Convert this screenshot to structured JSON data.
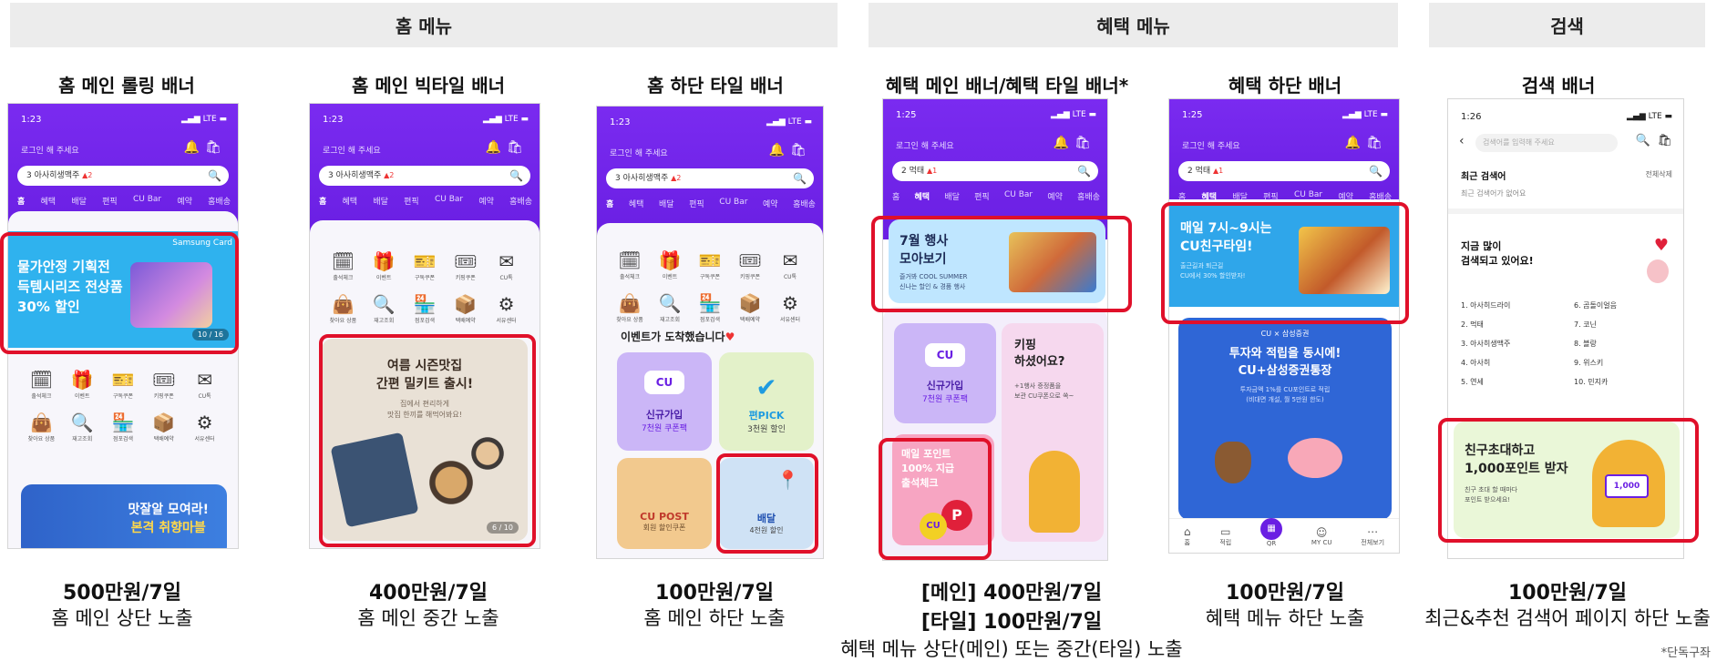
{
  "sections": {
    "home": "홈 메뉴",
    "benefit": "혜택 메뉴",
    "search": "검색"
  },
  "columns": [
    {
      "title": "홈 메인 롤링 배너",
      "price": "500만원/7일",
      "desc": "홈 메인 상단 노출"
    },
    {
      "title": "홈 메인 빅타일 배너",
      "price": "400만원/7일",
      "desc": "홈 메인 중간 노출"
    },
    {
      "title": "홈 하단 타일 배너",
      "price": "100만원/7일",
      "desc": "홈 메인 하단 노출"
    },
    {
      "title": "혜택 메인 배너/혜택 타일 배너*",
      "price_main": "[메인] 400만원/7일",
      "price_tile": "[타일] 100만원/7일",
      "desc": "혜택 메뉴 상단(메인) 또는 중간(타일) 노출"
    },
    {
      "title": "혜택 하단 배너",
      "price": "100만원/7일",
      "desc": "혜택 메뉴 하단 노출"
    },
    {
      "title": "검색 배너",
      "price": "100만원/7일",
      "desc": "최근&추천 검색어 페이지 하단 노출"
    }
  ],
  "note": "*단독구좌",
  "phone": {
    "time_a": "1:23",
    "time_b": "1:25",
    "time_c": "1:26",
    "signal": "▂▄▆ LTE ▬",
    "login": "로그인 해 주세요",
    "search_home": "3  아사히생맥주",
    "search_home_rank": "▲2",
    "search_benefit": "2  먹태",
    "search_benefit_rank": "▲1",
    "tabs": [
      "홈",
      "혜택",
      "배달",
      "편픽",
      "CU Bar",
      "예약",
      "홈배송"
    ],
    "icons": [
      {
        "icon": "calendar-check-icon",
        "glyph": "🗓",
        "label": "출석체크"
      },
      {
        "icon": "gift-icon",
        "glyph": "🎁",
        "label": "이벤트"
      },
      {
        "icon": "coupon-icon",
        "glyph": "🎫",
        "label": "구독쿠폰"
      },
      {
        "icon": "ticket-icon",
        "glyph": "🎟",
        "label": "키핑쿠폰"
      },
      {
        "icon": "mail-icon",
        "glyph": "✉",
        "label": "CU톡"
      },
      {
        "icon": "bag-icon",
        "glyph": "👜",
        "label": "찾아요 상품"
      },
      {
        "icon": "search-doc-icon",
        "glyph": "🔍",
        "label": "재고조회"
      },
      {
        "icon": "store-icon",
        "glyph": "🏪",
        "label": "점포검색"
      },
      {
        "icon": "box-icon",
        "glyph": "📦",
        "label": "택배예약"
      },
      {
        "icon": "settings-icon",
        "glyph": "⚙",
        "label": "서유센터"
      }
    ]
  },
  "banners": {
    "rolling": {
      "line1": "물가안정 기획전",
      "line2": "득템시리즈 전상품",
      "line3": "30% 할인",
      "brand": "Samsung Card",
      "page": "10 / 16"
    },
    "rolling_next": {
      "line1": "맛잘알 모여라!",
      "line2": "본격 취향마블"
    },
    "bigtile": {
      "line1": "여름 시즌맛집",
      "line2": "간편 밀키트 출시!",
      "sub1": "집에서 편리하게",
      "sub2": "맛집 한끼를 해먹어봐요!",
      "page": "6 / 10"
    },
    "event_heading": "이벤트가 도착했습니다",
    "tile_signup": {
      "line1": "신규가입",
      "line2": "7천원 쿠폰팩"
    },
    "tile_pick": {
      "line1": "편PICK",
      "line2": "3천원 할인"
    },
    "tile_post": {
      "line1": "CU POST",
      "line2": "회원 할인쿠폰"
    },
    "tile_delivery": {
      "line1": "배달",
      "line2": "4천원 할인"
    },
    "benefit_main": {
      "line1": "7월 행사",
      "line2": "모아보기",
      "sub1": "즐거봐 COOL SUMMER",
      "sub2": "신나는 할인 & 경품 행사"
    },
    "benefit_keep": {
      "line1": "키핑",
      "line2": "하셨어요?",
      "sub1": "+1행사 증정품을",
      "sub2": "보관 CU쿠폰으로 쏙~"
    },
    "benefit_point": {
      "line1": "매일 포인트",
      "line2": "100% 지급",
      "line3": "출석체크"
    },
    "benefit_bottom": {
      "line1": "매일 7시~9시는",
      "line2": "CU친구타임!",
      "sub1": "출근길과 퇴근길",
      "sub2": "CU에서 30% 할인받자!"
    },
    "benefit_invest": {
      "brand": "CU × 삼성증권",
      "line1": "투자와 적립을 동시에!",
      "line2": "CU+삼성증권통장",
      "sub1": "투자금액 1%를 CU포인트로 적립",
      "sub2": "(비대면 개설, 월 5만원 한도)"
    },
    "bottom_nav": [
      "홈",
      "적립",
      "QR",
      "MY CU",
      "전체보기"
    ],
    "search_page": {
      "placeholder": "검색어를 입력해 주세요",
      "recent_title": "최근 검색어",
      "clear_all": "전체삭제",
      "recent_empty": "최근 검색어가 없어요",
      "popular_title1": "지금 많이",
      "popular_title2": "검색되고 있어요!",
      "ranks_left": [
        "1. 아사히드라이",
        "2. 먹태",
        "3. 아사히생맥주",
        "4. 아사히",
        "5. 연세"
      ],
      "ranks_right": [
        "6. 곰돌이얼음",
        "7. 코닌",
        "8. 블랑",
        "9. 위스키",
        "10. 민지카"
      ],
      "banner_line1": "친구초대하고",
      "banner_line2": "1,000포인트 받자",
      "banner_sub1": "친구 초대 할 때마다",
      "banner_sub2": "포인트 받으세요!",
      "banner_badge": "1,000"
    }
  },
  "colors": {
    "purple": "#6a1fe3",
    "highlight": "#e0102a",
    "sky": "#2bb5f0",
    "section_bg": "#ececec"
  }
}
